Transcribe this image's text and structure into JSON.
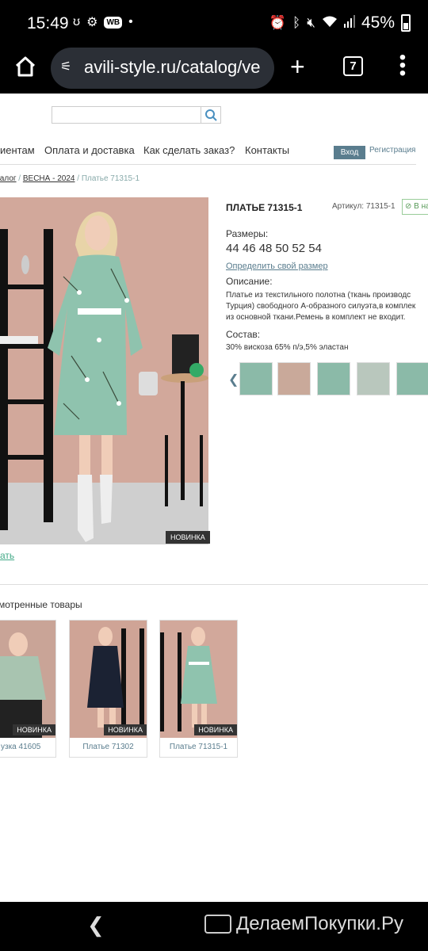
{
  "status": {
    "time": "15:49",
    "battery": "45%",
    "wb": "WB"
  },
  "browser": {
    "url": "avili-style.ru/catalog/ve",
    "tab_count": "7"
  },
  "nav": {
    "items": [
      "иентам",
      "Оплата и доставка",
      "Как сделать заказ?",
      "Контакты"
    ],
    "login": "Вход",
    "register": "Регистрация"
  },
  "breadcrumb": {
    "catalog": "аталог",
    "sep": " / ",
    "section": "ВЕСНА - 2024",
    "current": "Платье 71315-1"
  },
  "product": {
    "title": "ПЛАТЬЕ 71315-1",
    "article": "Артикул: 71315-1",
    "in_stock": "В на",
    "sizes_label": "Размеры:",
    "sizes": "44 46 48 50 52 54",
    "size_link": "Определить свой размер",
    "desc_label": "Описание:",
    "desc_line1": "Платье из  текстильного полотна (ткань производс",
    "desc_line2": "Турция) свободного А-образного силуэта,в комплек",
    "desc_line3": "из основной ткани.Ремень в комплект не входит.",
    "composition_label": "Состав:",
    "composition": "30% вискоза 65% п/э,5% эластан",
    "new_badge": "НОВИНКА",
    "collapse": "ать"
  },
  "viewed": {
    "title": "смотренные товары",
    "items": [
      {
        "name": "узка 41605",
        "badge": "НОВИНКА"
      },
      {
        "name": "Платье 71302",
        "badge": "НОВИНКА"
      },
      {
        "name": "Платье 71315-1",
        "badge": "НОВИНКА"
      }
    ]
  },
  "watermark": "ДелаемПокупки.Ру"
}
